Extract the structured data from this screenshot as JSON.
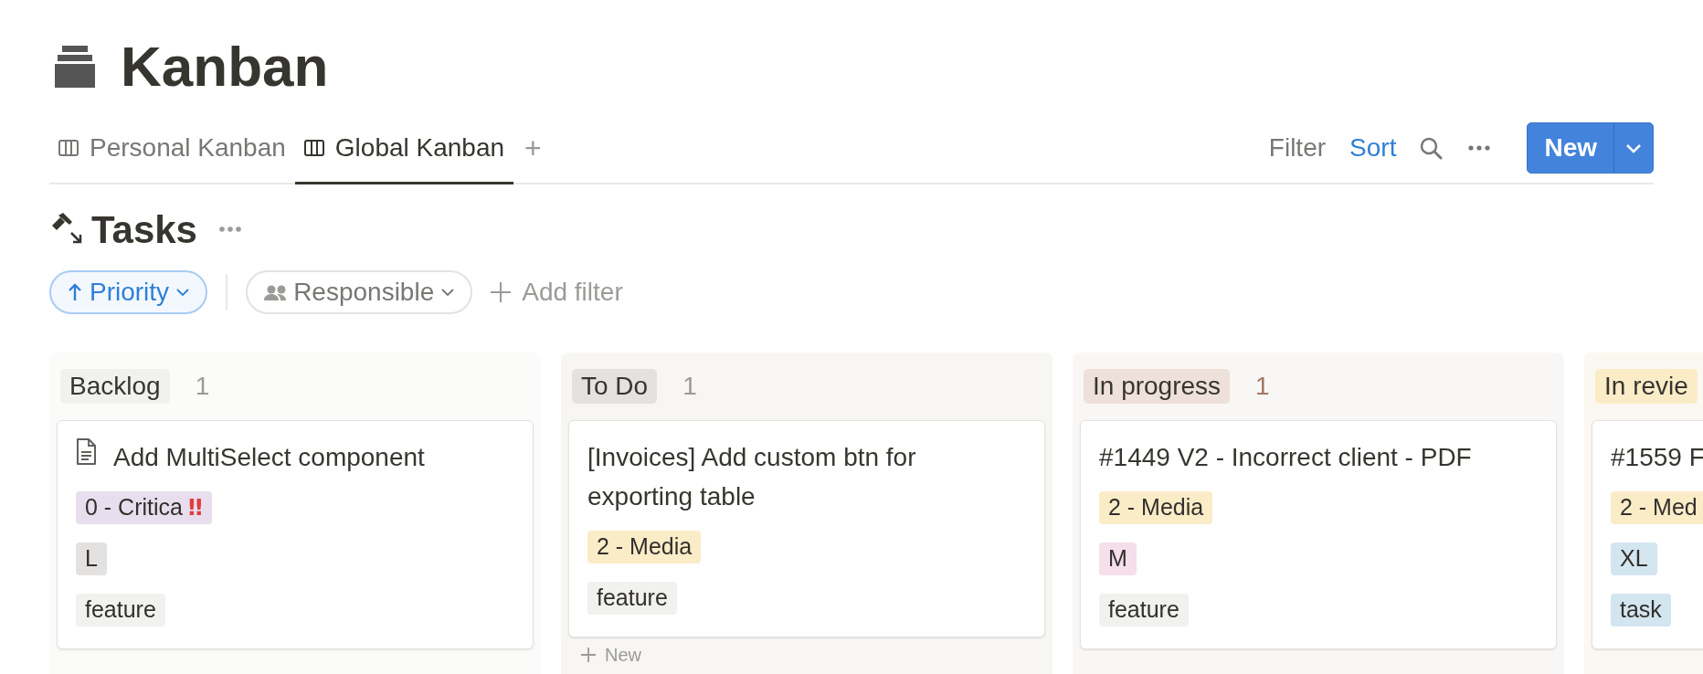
{
  "page": {
    "title": "Kanban"
  },
  "views": {
    "tabs": [
      {
        "label": "Personal Kanban",
        "selected": false
      },
      {
        "label": "Global Kanban",
        "selected": true
      }
    ],
    "add_label": "+"
  },
  "toolbar": {
    "actions": [
      {
        "label": "Filter",
        "active": false
      },
      {
        "label": "Sort",
        "active": true
      }
    ],
    "new_button": "New"
  },
  "database": {
    "title": "Tasks",
    "filters": [
      {
        "label": "Priority",
        "kind": "sort",
        "active": true
      },
      {
        "label": "Responsible",
        "kind": "person",
        "active": false
      }
    ],
    "add_filter": "Add filter"
  },
  "columns": [
    {
      "name": "Backlog",
      "count": "1",
      "color": "#f1f1ef",
      "cards": [
        {
          "title": "Add MultiSelect component",
          "page_icon": true,
          "tags": [
            {
              "label": "0 - Critica",
              "mark": "‼",
              "color": "#e8deee"
            },
            {
              "label": "L",
              "color": "#e3e2e0"
            },
            {
              "label": "feature",
              "color": "#f1f1ef"
            }
          ]
        }
      ]
    },
    {
      "name": "To Do",
      "count": "1",
      "color": "#e3e2e0",
      "cards": [
        {
          "title": "[Invoices] Add custom btn for exporting table",
          "page_icon": false,
          "tags": [
            {
              "label": "2 - Media",
              "color": "#fbecc8"
            },
            {
              "label": "feature",
              "color": "#f1f1ef"
            }
          ]
        }
      ],
      "add_label": "New"
    },
    {
      "name": "In progress",
      "count": "1",
      "color": "#eee0da",
      "cards": [
        {
          "title": "#1449 V2 -  Incorrect client - PDF",
          "page_icon": false,
          "tags": [
            {
              "label": "2 - Media",
              "color": "#fbecc8"
            },
            {
              "label": "M",
              "color": "#f4dfeb"
            },
            {
              "label": "feature",
              "color": "#f1f1ef"
            }
          ]
        }
      ]
    },
    {
      "name": "In revie",
      "color": "#fbecc8",
      "cards": [
        {
          "title": "#1559 F",
          "page_icon": false,
          "tags": [
            {
              "label": "2 - Med",
              "color": "#fbecc8"
            },
            {
              "label": "XL",
              "color": "#d3e5ef"
            },
            {
              "label": "task",
              "color": "#d3e5ef"
            }
          ]
        }
      ]
    }
  ]
}
